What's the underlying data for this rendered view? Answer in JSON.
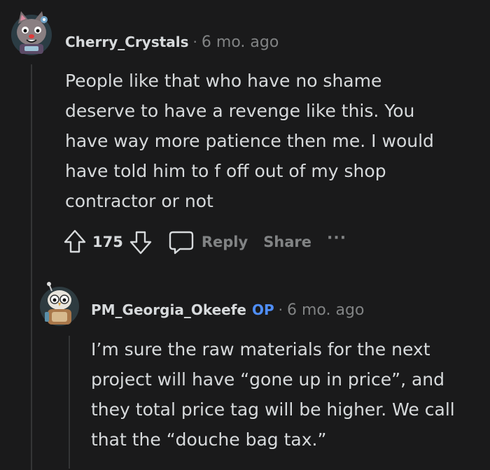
{
  "comments": [
    {
      "username": "Cherry_Crystals",
      "separator": "·",
      "time": "6 mo. ago",
      "body_lines": [
        "People like that who have no shame",
        "deserve to have a revenge like this. You",
        "have way more patience then me. I would",
        "have told him to f off out of my shop",
        "contractor or not"
      ],
      "score": "175",
      "reply_label": "Reply",
      "share_label": "Share",
      "more_label": "···",
      "icons": [
        "upvote-icon",
        "downvote-icon",
        "comment-bubble-icon",
        "more-options-icon"
      ]
    },
    {
      "username": "PM_Georgia_Okeefe",
      "op_badge": "OP",
      "separator": "·",
      "time": "6 mo. ago",
      "body_lines": [
        "I’m sure the raw materials for the next",
        "project will have “gone up in price”, and",
        "they total price tag will be higher. We call",
        "that the “douche bag tax.”"
      ]
    }
  ],
  "colors": {
    "background": "#1a1a1b",
    "text": "#d7dadc",
    "muted": "#818384",
    "op": "#4f8ef7",
    "thread_line": "#343536"
  }
}
